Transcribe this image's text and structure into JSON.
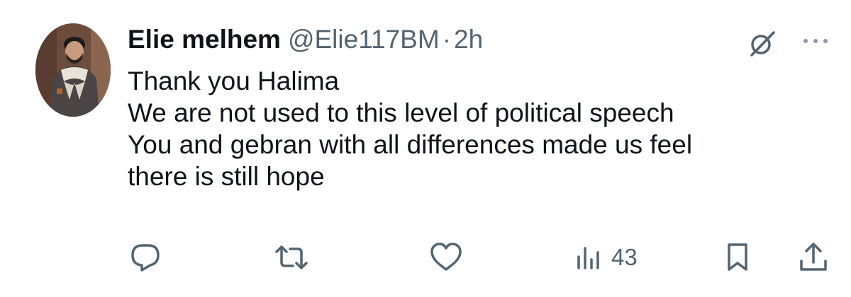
{
  "tweet": {
    "author_name": "Elie melhem",
    "handle": "@Elie117BM",
    "separator": "·",
    "time": "2h",
    "lines": [
      "Thank you Halima",
      "We are not used to this level of political speech",
      "You and gebran with all differences made us feel",
      "there is still hope"
    ]
  },
  "actions": {
    "reply_icon": "reply-icon",
    "retweet_icon": "retweet-icon",
    "like_icon": "heart-icon",
    "views_icon": "views-icon",
    "views_count": "43",
    "bookmark_icon": "bookmark-icon",
    "share_icon": "share-icon"
  },
  "colors": {
    "text": "#0f1419",
    "secondary": "#536471",
    "background": "#ffffff"
  }
}
